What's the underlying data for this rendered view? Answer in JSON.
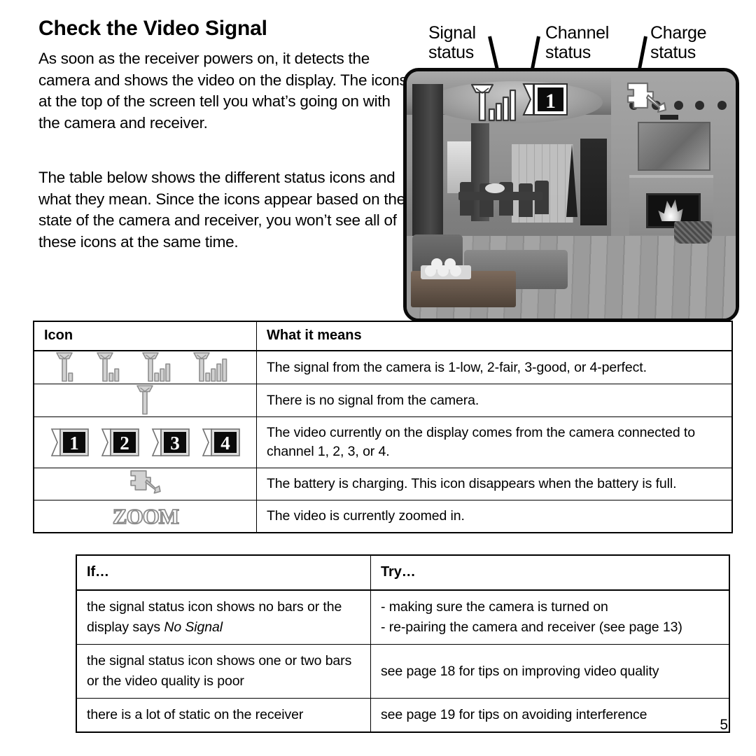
{
  "page": {
    "title": "Check the Video Signal",
    "number": "5"
  },
  "paragraphs": {
    "intro": "As soon as the receiver powers on, it detects the camera and shows the video on the display. The icons at the top of the screen tell you what’s going on with the camera and receiver.",
    "table_intro": "The table below shows the different status icons and what they mean. Since the icons appear based on the state of the camera and receiver, you won’t see all of these icons at the same time."
  },
  "figure": {
    "callouts": [
      {
        "id": "signal-status",
        "label": "Signal\nstatus",
        "icon": "signal-bars-icon"
      },
      {
        "id": "channel-status",
        "label": "Channel\nstatus",
        "icon": "channel-number-icon"
      },
      {
        "id": "charge-status",
        "label": "Charge\nstatus",
        "icon": "battery-charging-icon"
      }
    ],
    "osd": {
      "signal_bars": 4,
      "channel_number": "1",
      "charging": true
    }
  },
  "icon_table": {
    "headers": [
      "Icon",
      "What it means"
    ],
    "rows": [
      {
        "icon_name": "signal-strength-icons",
        "icon_kind": "signal-levels",
        "levels": [
          1,
          2,
          3,
          4
        ],
        "meaning": "The signal from the camera is 1-low, 2-fair, 3-good, or 4-perfect."
      },
      {
        "icon_name": "no-signal-icon",
        "icon_kind": "signal-levels",
        "levels": [
          0
        ],
        "meaning": "There is no signal from the camera."
      },
      {
        "icon_name": "channel-number-icons",
        "icon_kind": "channels",
        "channels": [
          "1",
          "2",
          "3",
          "4"
        ],
        "meaning": "The video currently on the display comes from the camera connected to channel 1, 2, 3, or 4."
      },
      {
        "icon_name": "battery-charging-icon",
        "icon_kind": "charge",
        "meaning": "The battery is charging. This icon disappears when the battery is full."
      },
      {
        "icon_name": "zoom-icon",
        "icon_kind": "zoom",
        "zoom_label": "ZOOM",
        "meaning": "The video is currently zoomed in."
      }
    ]
  },
  "try_table": {
    "headers": [
      "If…",
      "Try…"
    ],
    "rows": [
      {
        "if_prefix": "the signal status icon shows no bars or the display says ",
        "if_italic": "No Signal",
        "try_lines": [
          "- making sure the camera is turned on",
          "- re-pairing the camera and receiver (see page 13)"
        ]
      },
      {
        "if_prefix": "the signal status icon shows one or two bars or the video quality is poor",
        "if_italic": "",
        "try_lines": [
          "see page 18 for tips on improving video quality"
        ]
      },
      {
        "if_prefix": "there is a lot of static on the receiver",
        "if_italic": "",
        "try_lines": [
          "see page 19 for tips on avoiding interference"
        ]
      }
    ]
  },
  "colors": {
    "text": "#000000",
    "icon_fill": "#c9c9c9",
    "icon_stroke": "#6b6b6b",
    "rule": "#000000"
  }
}
